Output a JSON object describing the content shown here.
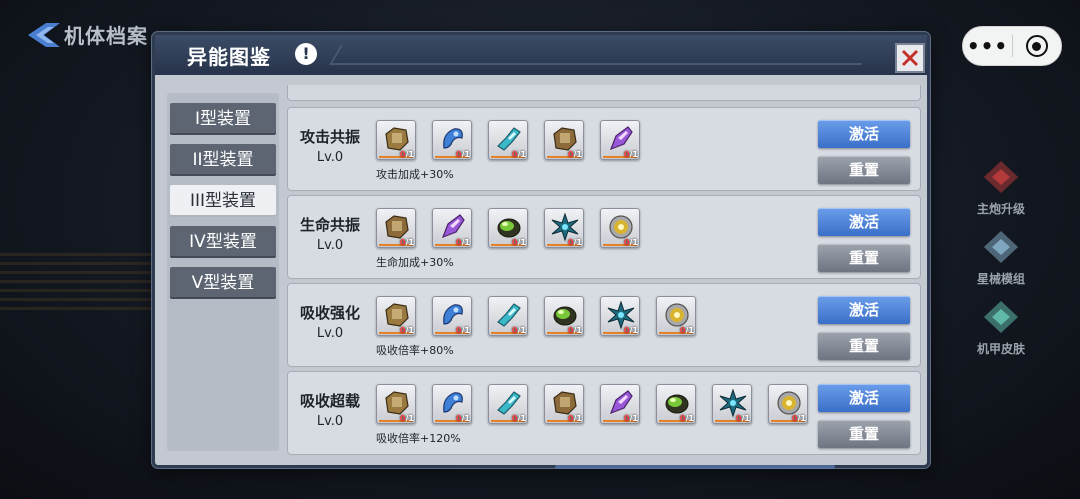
{
  "header": {
    "back_title": "机体档案"
  },
  "capsule": {
    "more": "•••"
  },
  "side_menu": [
    {
      "label": "主炮升级",
      "color": "#b33a3a",
      "icon": "cannon-icon"
    },
    {
      "label": "星械模组",
      "color": "#7fa8c0",
      "icon": "module-icon"
    },
    {
      "label": "机甲皮肤",
      "color": "#5fb8a8",
      "icon": "skin-icon"
    }
  ],
  "panel": {
    "title": "异能图鉴",
    "warn": "!",
    "tabs": [
      {
        "label": "I型装置",
        "active": false
      },
      {
        "label": "II型装置",
        "active": false
      },
      {
        "label": "III型装置",
        "active": true
      },
      {
        "label": "IV型装置",
        "active": false
      },
      {
        "label": "V型装置",
        "active": false
      }
    ],
    "rows": [
      {
        "name": "攻击共振",
        "level": "Lv.0",
        "bonus": "攻击加成+30%",
        "items": [
          {
            "icon": "mech-fist-icon",
            "color": "#9a7a40",
            "count": "0",
            "total": "/1"
          },
          {
            "icon": "blue-claw-icon",
            "color": "#3f7fd6",
            "count": "0",
            "total": "/1"
          },
          {
            "icon": "cyan-crystal-icon",
            "color": "#3bb8c8",
            "count": "0",
            "total": "/1"
          },
          {
            "icon": "brown-core-icon",
            "color": "#8c6a3a",
            "count": "0",
            "total": "/1"
          },
          {
            "icon": "purple-crystal-icon",
            "color": "#9a58d8",
            "count": "0",
            "total": "/1"
          }
        ],
        "activate": "激活",
        "reset": "重置"
      },
      {
        "name": "生命共振",
        "level": "Lv.0",
        "bonus": "生命加成+30%",
        "items": [
          {
            "icon": "brown-core-icon",
            "color": "#8c6a3a",
            "count": "0",
            "total": "/1"
          },
          {
            "icon": "purple-crystal-icon",
            "color": "#9a58d8",
            "count": "0",
            "total": "/1"
          },
          {
            "icon": "green-orb-icon",
            "color": "#7ac83a",
            "count": "0",
            "total": "/1"
          },
          {
            "icon": "cyan-star-icon",
            "color": "#1f6b80",
            "count": "0",
            "total": "/1"
          },
          {
            "icon": "gold-gear-icon",
            "color": "#d8b430",
            "count": "0",
            "total": "/1"
          }
        ],
        "activate": "激活",
        "reset": "重置"
      },
      {
        "name": "吸收强化",
        "level": "Lv.0",
        "bonus": "吸收倍率+80%",
        "items": [
          {
            "icon": "mech-fist-icon",
            "color": "#9a7a40",
            "count": "0",
            "total": "/1"
          },
          {
            "icon": "blue-claw-icon",
            "color": "#3f7fd6",
            "count": "0",
            "total": "/1"
          },
          {
            "icon": "cyan-crystal-icon",
            "color": "#3bb8c8",
            "count": "0",
            "total": "/1"
          },
          {
            "icon": "green-orb-icon",
            "color": "#7ac83a",
            "count": "0",
            "total": "/1"
          },
          {
            "icon": "cyan-star-icon",
            "color": "#1f6b80",
            "count": "0",
            "total": "/1"
          },
          {
            "icon": "gold-gear-icon",
            "color": "#d8b430",
            "count": "0",
            "total": "/1"
          }
        ],
        "activate": "激活",
        "reset": "重置"
      },
      {
        "name": "吸收超载",
        "level": "Lv.0",
        "bonus": "吸收倍率+120%",
        "items": [
          {
            "icon": "mech-fist-icon",
            "color": "#9a7a40",
            "count": "0",
            "total": "/1"
          },
          {
            "icon": "blue-claw-icon",
            "color": "#3f7fd6",
            "count": "0",
            "total": "/1"
          },
          {
            "icon": "cyan-crystal-icon",
            "color": "#3bb8c8",
            "count": "0",
            "total": "/1"
          },
          {
            "icon": "brown-core-icon",
            "color": "#8c6a3a",
            "count": "0",
            "total": "/1"
          },
          {
            "icon": "purple-crystal-icon",
            "color": "#9a58d8",
            "count": "0",
            "total": "/1"
          },
          {
            "icon": "green-orb-icon",
            "color": "#7ac83a",
            "count": "0",
            "total": "/1"
          },
          {
            "icon": "cyan-star-icon",
            "color": "#1f6b80",
            "count": "0",
            "total": "/1"
          },
          {
            "icon": "gold-gear-icon",
            "color": "#d8b430",
            "count": "0",
            "total": "/1"
          }
        ],
        "activate": "激活",
        "reset": "重置"
      }
    ]
  }
}
